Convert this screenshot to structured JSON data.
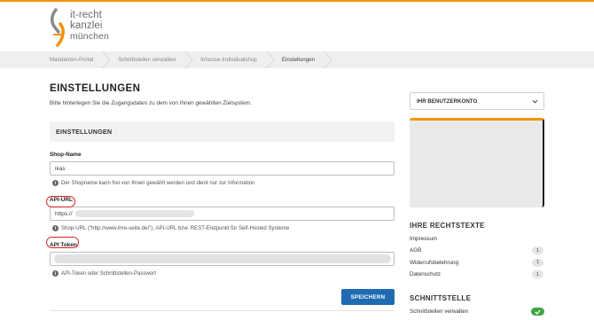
{
  "brand": {
    "line1": "it-recht",
    "line2": "kanzlei",
    "line3": "münchen",
    "accent": "#f39200"
  },
  "breadcrumb": [
    "Mandanten-Portal",
    "Schnittstellen verwalten",
    "Inhouse-Individualshop",
    "Einstellungen"
  ],
  "main": {
    "title": "EINSTELLUNGEN",
    "description": "Bitte hinterlegen Sie die Zugangsdaten zu dem von Ihnen gewählten Zielsystem.",
    "section_title": "EINSTELLUNGEN",
    "fields": {
      "shop_name": {
        "label": "Shop-Name",
        "value": "ikas",
        "help": "Der Shopname kann frei von Ihnen gewählt werden und dient nur zur Information"
      },
      "api_url": {
        "label": "API-URL",
        "value": "https://",
        "help": "Shop-URL (\"http://www.ihre-seite.de/\"), API-URL bzw. REST-Endpunkt für Self-Hosted Systeme"
      },
      "api_token": {
        "label": "API Token",
        "value": "",
        "help": "API-Token oder Schnittstellen-Passwort"
      }
    },
    "save_label": "SPEICHERN",
    "save_color": "#1e6bb3"
  },
  "sidebar": {
    "account_label": "IHR BENUTZERKONTO",
    "rechtstexte_title": "IHRE RECHTSTEXTE",
    "rechtstexte": [
      {
        "label": "Impressum",
        "count": ""
      },
      {
        "label": "AGB",
        "count": "1"
      },
      {
        "label": "Widerrufsbelehrung",
        "count": "1"
      },
      {
        "label": "Datenschutz",
        "count": "1"
      }
    ],
    "schnittstelle_title": "SCHNITTSTELLE",
    "schnittstelle_item": "Schnittstellen verwalten",
    "check_color": "#3fa33f"
  },
  "highlight_color": "#dd2222",
  "icons": {
    "info": "info-icon",
    "chevron": "chevron-down-icon",
    "check": "check-icon",
    "logo": "logo-icon"
  }
}
